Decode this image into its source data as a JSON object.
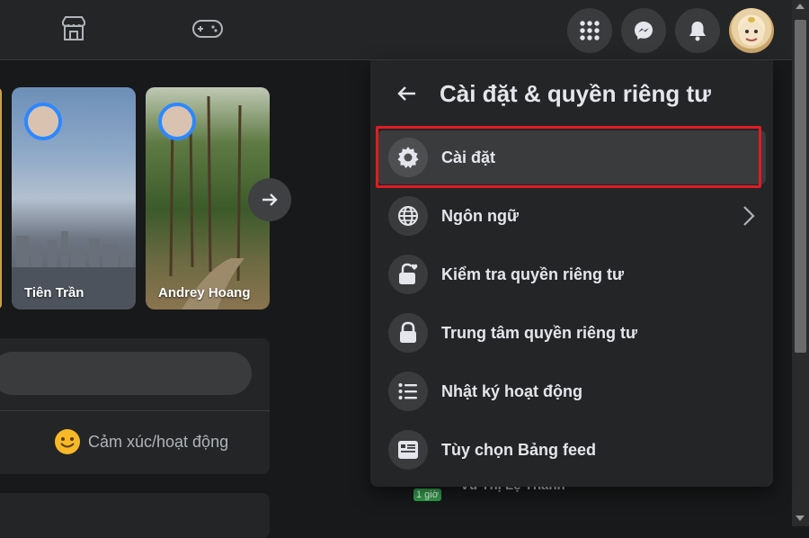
{
  "topbar": {
    "icons": [
      "marketplace-icon",
      "gaming-icon",
      "menu-grid-icon",
      "messenger-icon",
      "notifications-icon"
    ]
  },
  "stories": [
    {
      "name": "Tiên Trần"
    },
    {
      "name": "Andrey Hoang"
    }
  ],
  "composer": {
    "feeling_label": "Cảm xúc/hoạt động"
  },
  "panel": {
    "title": "Cài đặt & quyền riêng tư",
    "items": [
      {
        "label": "Cài đặt",
        "icon": "gear-icon"
      },
      {
        "label": "Ngôn ngữ",
        "icon": "globe-icon"
      },
      {
        "label": "Kiểm tra quyền riêng tư",
        "icon": "lock-heart-icon"
      },
      {
        "label": "Trung tâm quyền riêng tư",
        "icon": "lock-icon"
      },
      {
        "label": "Nhật ký hoạt động",
        "icon": "list-icon"
      },
      {
        "label": "Tùy chọn Bảng feed",
        "icon": "feed-icon"
      }
    ]
  },
  "background_contact": {
    "badge": "1 giờ",
    "name": "Vũ Thị Lệ Thanh"
  },
  "colors": {
    "background": "#18191a",
    "surface": "#242526",
    "hover": "#3a3b3c",
    "text": "#e4e6eb",
    "annotation_red": "#e01b24",
    "accent": "#2d88ff"
  }
}
